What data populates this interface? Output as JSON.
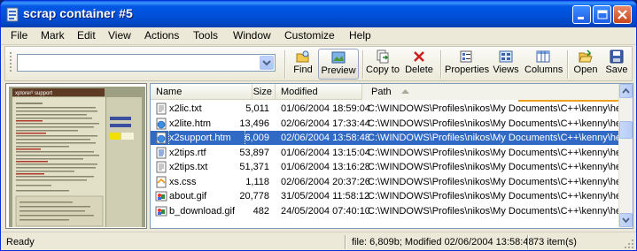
{
  "window": {
    "title": "scrap container #5",
    "controls": [
      "minimize",
      "maximize",
      "close"
    ]
  },
  "menu": {
    "items": [
      "File",
      "Mark",
      "Edit",
      "View",
      "Actions",
      "Tools",
      "Window",
      "Customize",
      "Help"
    ]
  },
  "toolbar": {
    "path_value": "",
    "buttons": [
      {
        "label": "Find",
        "icon": "find-icon"
      },
      {
        "label": "Preview",
        "icon": "preview-icon",
        "active": true
      },
      {
        "label": "Copy to",
        "icon": "copy-to-icon"
      },
      {
        "label": "Delete",
        "icon": "delete-icon"
      },
      {
        "label": "Properties",
        "icon": "properties-icon"
      },
      {
        "label": "Views",
        "icon": "views-icon"
      },
      {
        "label": "Columns",
        "icon": "columns-icon"
      },
      {
        "label": "Open",
        "icon": "open-icon"
      },
      {
        "label": "Save",
        "icon": "save-icon"
      }
    ]
  },
  "list": {
    "columns": [
      "Name",
      "Size",
      "Modified",
      "Path"
    ],
    "sorted_column": "Path",
    "rows": [
      {
        "name": "x2lic.txt",
        "size": "5,011",
        "modified": "01/06/2004 18:59:04",
        "path": "C:\\WINDOWS\\Profiles\\nikos\\My Documents\\C++\\kenny\\help\\",
        "type": "txt"
      },
      {
        "name": "x2lite.htm",
        "size": "13,496",
        "modified": "02/06/2004 17:33:44",
        "path": "C:\\WINDOWS\\Profiles\\nikos\\My Documents\\C++\\kenny\\help\\",
        "type": "htm"
      },
      {
        "name": "x2support.htm",
        "size": "6,009",
        "modified": "02/06/2004 13:58:48",
        "path": "C:\\WINDOWS\\Profiles\\nikos\\My Documents\\C++\\kenny\\help\\",
        "type": "htm",
        "selected": true
      },
      {
        "name": "x2tips.rtf",
        "size": "53,897",
        "modified": "01/06/2004 13:15:04",
        "path": "C:\\WINDOWS\\Profiles\\nikos\\My Documents\\C++\\kenny\\help\\",
        "type": "rtf"
      },
      {
        "name": "x2tips.txt",
        "size": "51,371",
        "modified": "01/06/2004 13:16:28",
        "path": "C:\\WINDOWS\\Profiles\\nikos\\My Documents\\C++\\kenny\\help\\",
        "type": "txt"
      },
      {
        "name": "xs.css",
        "size": "1,118",
        "modified": "02/06/2004 20:37:26",
        "path": "C:\\WINDOWS\\Profiles\\nikos\\My Documents\\C++\\kenny\\help\\",
        "type": "css"
      },
      {
        "name": "about.gif",
        "size": "20,778",
        "modified": "31/05/2004 11:58:12",
        "path": "C:\\WINDOWS\\Profiles\\nikos\\My Documents\\C++\\kenny\\help\\pic\\",
        "type": "gif"
      },
      {
        "name": "b_download.gif",
        "size": "482",
        "modified": "24/05/2004 07:40:10",
        "path": "C:\\WINDOWS\\Profiles\\nikos\\My Documents\\C++\\kenny\\help\\pic\\",
        "type": "gif"
      }
    ]
  },
  "status": {
    "state": "Ready",
    "file_info": "file: 6,809b; Modified 02/06/2004 13:58:48",
    "count": "73 item(s)"
  },
  "preview": {
    "doc_title": "xplorer² support"
  }
}
